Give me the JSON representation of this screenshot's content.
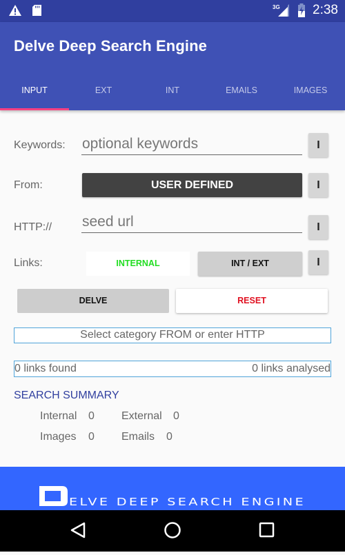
{
  "status_bar": {
    "time": "2:38",
    "network": "3G",
    "icons": [
      "warning-icon",
      "sd-card-icon",
      "signal-icon",
      "battery-charging-icon"
    ]
  },
  "app_bar": {
    "title": "Delve Deep Search Engine"
  },
  "tabs": [
    {
      "label": "INPUT",
      "active": true
    },
    {
      "label": "EXT",
      "active": false
    },
    {
      "label": "INT",
      "active": false
    },
    {
      "label": "EMAILS",
      "active": false
    },
    {
      "label": "IMAGES",
      "active": false
    }
  ],
  "form": {
    "keywords": {
      "label": "Keywords:",
      "placeholder": "optional keywords",
      "value": "",
      "info_label": "I"
    },
    "from": {
      "label": "From:",
      "button_label": "USER DEFINED",
      "info_label": "I"
    },
    "http": {
      "label": "HTTP://",
      "placeholder": "seed url",
      "value": "",
      "info_label": "I"
    },
    "links": {
      "label": "Links:",
      "internal_label": "INTERNAL",
      "intext_label": "INT / EXT",
      "info_label": "I"
    }
  },
  "actions": {
    "delve_label": "DELVE",
    "reset_label": "RESET"
  },
  "status_message": "Select category FROM or enter HTTP",
  "links_status": {
    "found": "0 links found",
    "analysed": "0 links analysed"
  },
  "summary": {
    "title": "SEARCH SUMMARY",
    "internal_label": "Internal",
    "internal_value": "0",
    "external_label": "External",
    "external_value": "0",
    "images_label": "Images",
    "images_value": "0",
    "emails_label": "Emails",
    "emails_value": "0"
  },
  "footer": {
    "logo_initial": "D",
    "logo_text": "ELVE DEEP SEARCH ENGINE"
  },
  "colors": {
    "primary": "#3f51b5",
    "primary_dark": "#303f9f",
    "accent": "#ff4081",
    "footer": "#3366ff",
    "internal_green": "#22dd22",
    "reset_red": "#e01020"
  }
}
